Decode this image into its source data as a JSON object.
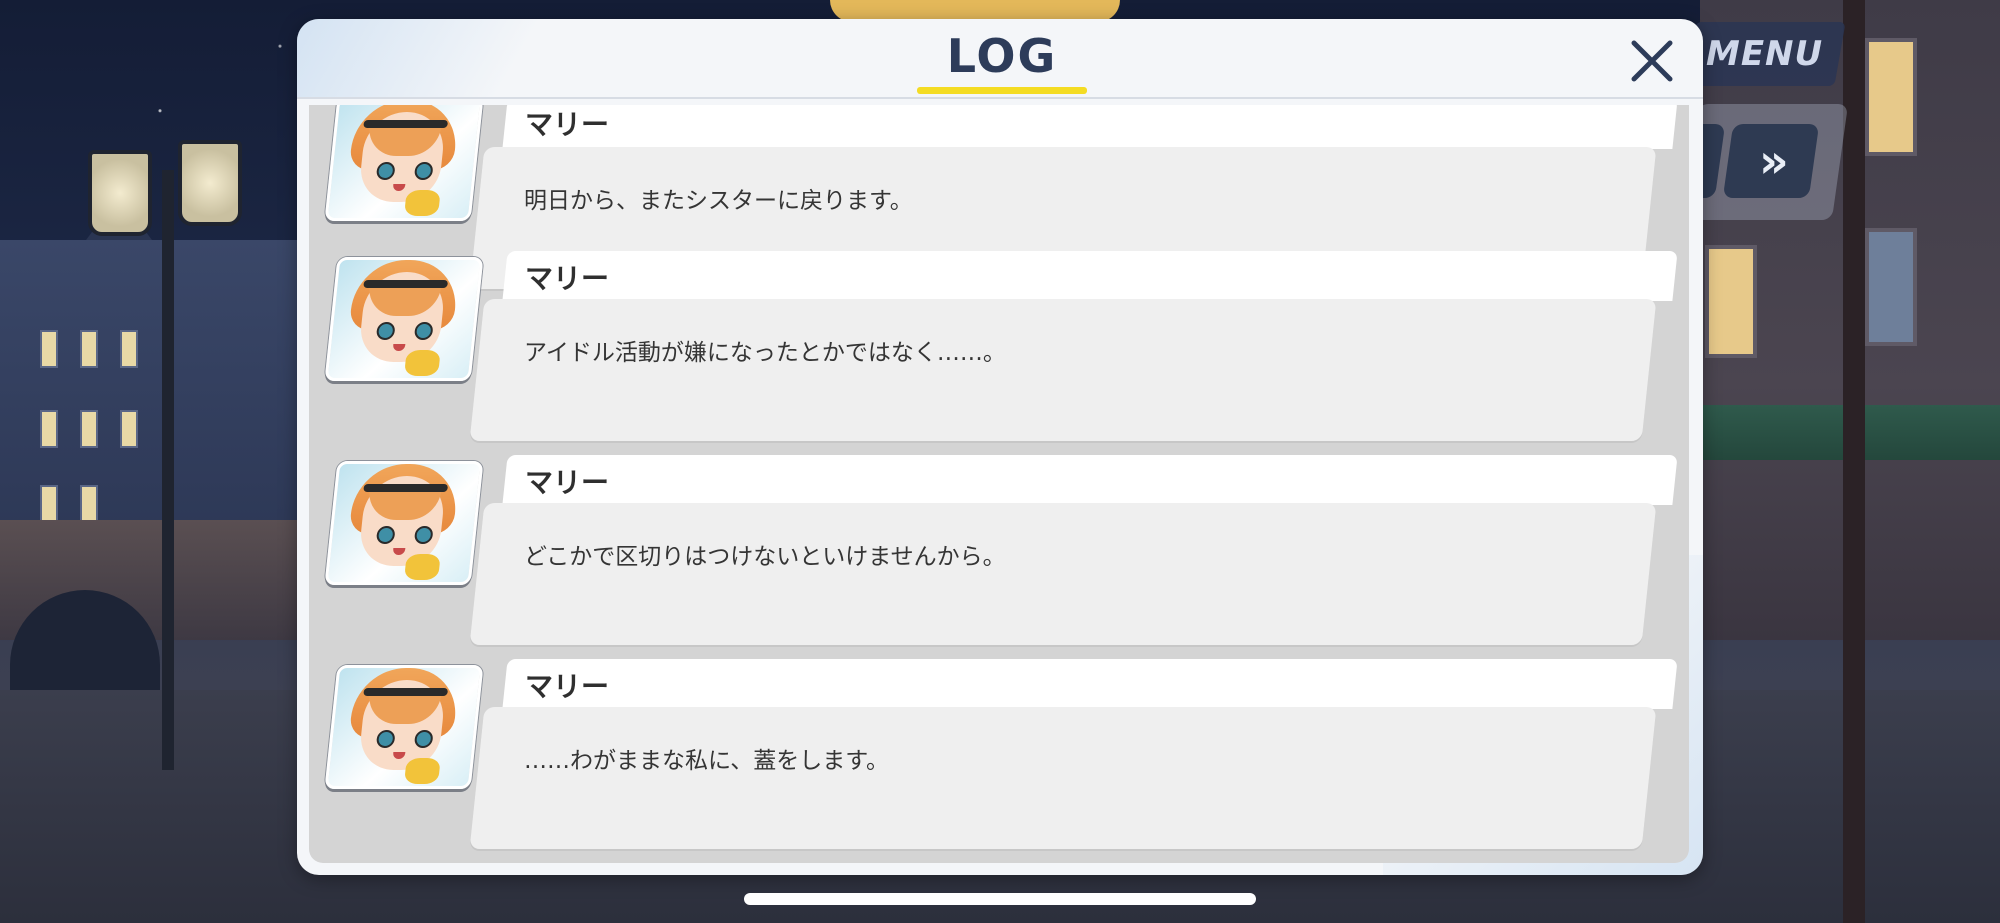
{
  "top_controls": {
    "menu_label": "MENU",
    "fast_forward_icon": "double-chevron-right-icon",
    "fast_forward_glyph": "»"
  },
  "log": {
    "title": "LOG",
    "close_icon": "close-x-icon",
    "accent_color": "#f4dc24",
    "entries": [
      {
        "speaker": "マリー",
        "text": "明日から、またシスターに戻ります。"
      },
      {
        "speaker": "マリー",
        "text": "アイドル活動が嫌になったとかではなく……。"
      },
      {
        "speaker": "マリー",
        "text": "どこかで区切りはつけないといけませんから。"
      },
      {
        "speaker": "マリー",
        "text": "……わがままな私に、蓋をします。"
      }
    ]
  }
}
